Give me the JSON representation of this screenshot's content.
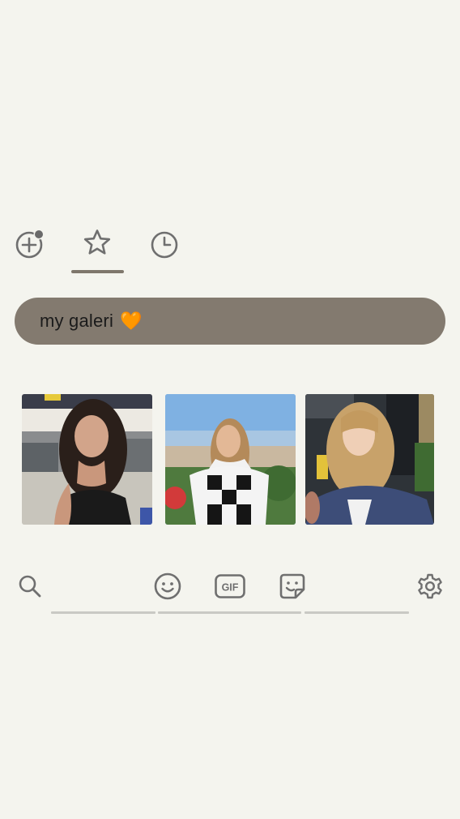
{
  "top_tabs": {
    "items": [
      {
        "name": "add",
        "icon": "add-circle-icon",
        "badge": true
      },
      {
        "name": "favorites",
        "icon": "star-icon",
        "selected": true
      },
      {
        "name": "recent",
        "icon": "clock-icon"
      }
    ]
  },
  "collection": {
    "label": "my galeri",
    "emoji": "🧡"
  },
  "thumbnails": [
    {
      "description": "photo"
    },
    {
      "description": "photo"
    },
    {
      "description": "photo"
    }
  ],
  "bottom_bar": {
    "icons": [
      "search-icon",
      "emoji-icon",
      "gif-icon",
      "sticker-icon",
      "gear-icon"
    ],
    "gif_text": "GIF"
  },
  "colors": {
    "background": "#f4f4ee",
    "pill": "#837a6f",
    "icon": "#6f6f6f",
    "indicator": "#7f776c",
    "badge": "#6a6a6a"
  }
}
